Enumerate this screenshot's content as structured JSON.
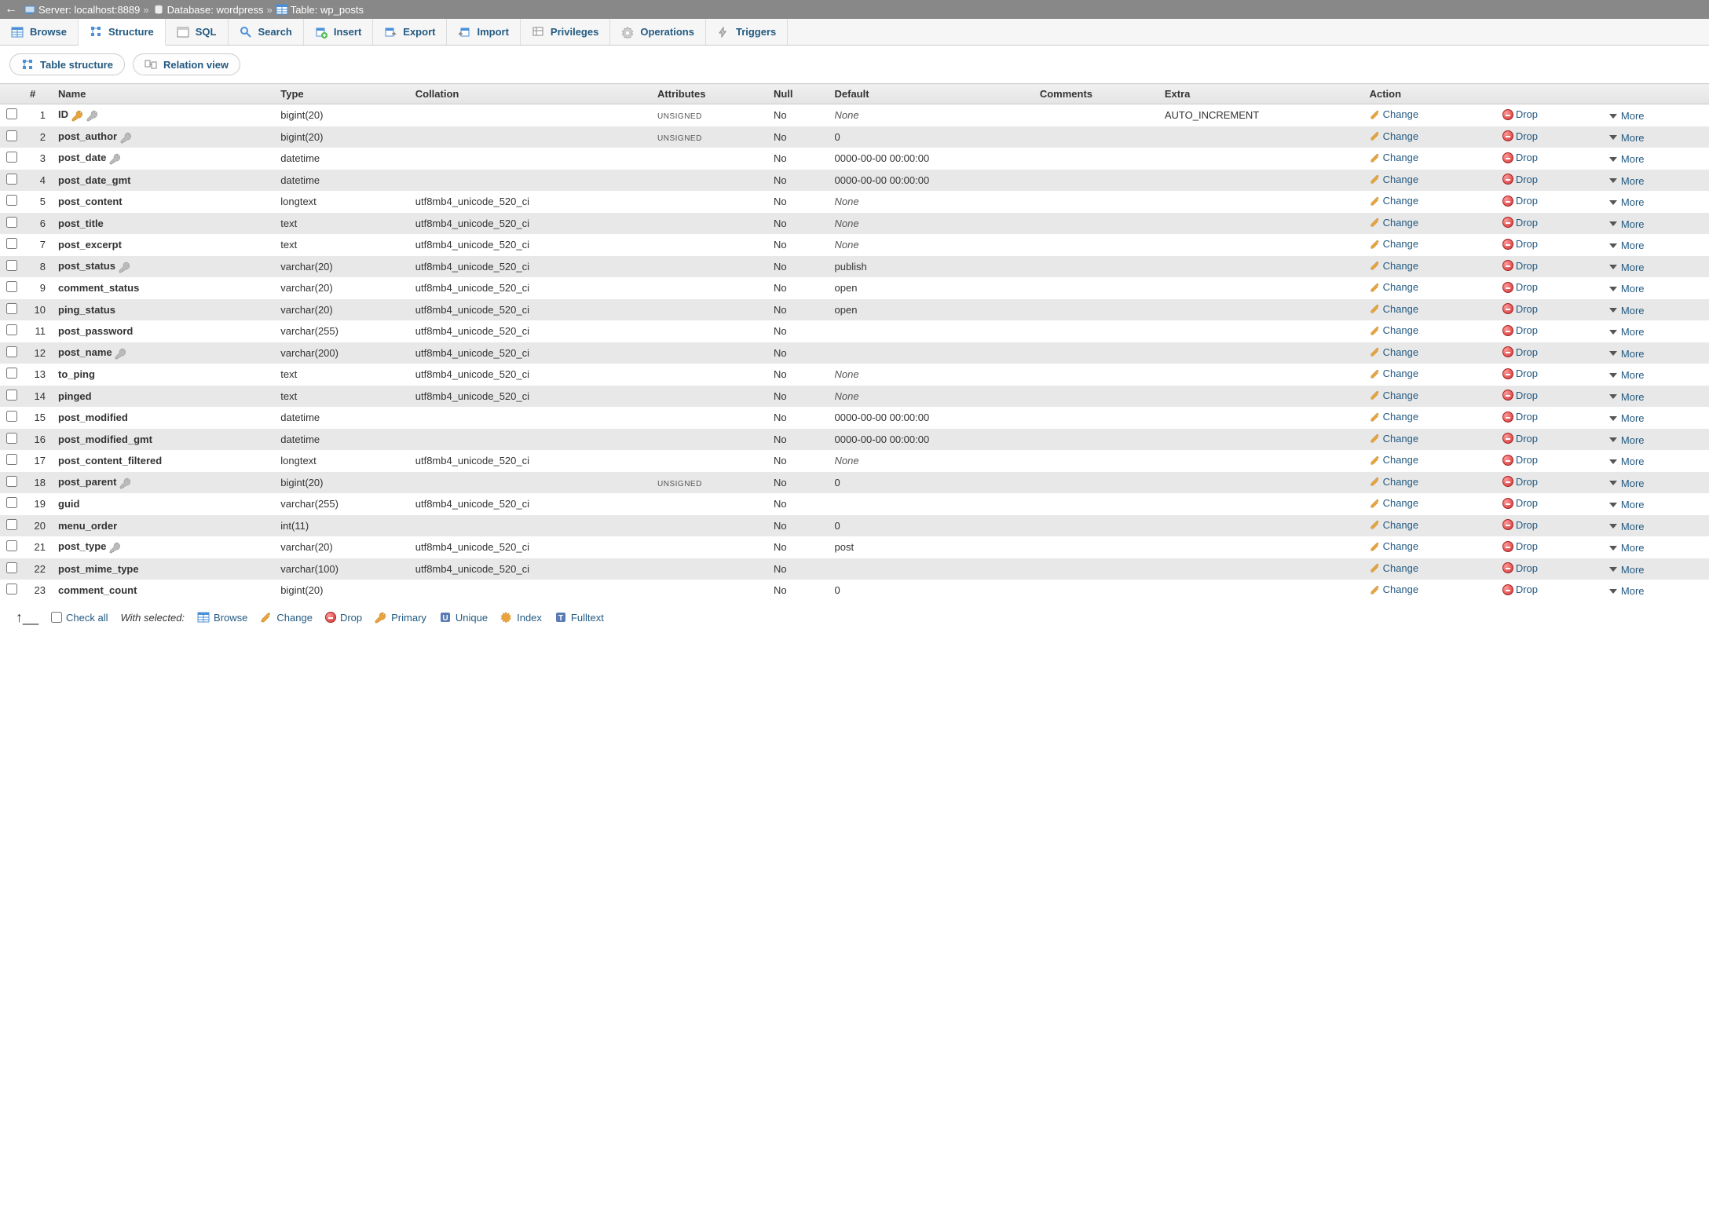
{
  "breadcrumb": {
    "server_label": "Server:",
    "server_value": "localhost:8889",
    "database_label": "Database:",
    "database_value": "wordpress",
    "table_label": "Table:",
    "table_value": "wp_posts"
  },
  "tabs": [
    {
      "id": "browse",
      "label": "Browse"
    },
    {
      "id": "structure",
      "label": "Structure",
      "active": true
    },
    {
      "id": "sql",
      "label": "SQL"
    },
    {
      "id": "search",
      "label": "Search"
    },
    {
      "id": "insert",
      "label": "Insert"
    },
    {
      "id": "export",
      "label": "Export"
    },
    {
      "id": "import",
      "label": "Import"
    },
    {
      "id": "privileges",
      "label": "Privileges"
    },
    {
      "id": "operations",
      "label": "Operations"
    },
    {
      "id": "triggers",
      "label": "Triggers"
    }
  ],
  "subtabs": {
    "table_structure": "Table structure",
    "relation_view": "Relation view"
  },
  "headers": {
    "num": "#",
    "name": "Name",
    "type": "Type",
    "collation": "Collation",
    "attributes": "Attributes",
    "null": "Null",
    "default": "Default",
    "comments": "Comments",
    "extra": "Extra",
    "action": "Action"
  },
  "actions": {
    "change": "Change",
    "drop": "Drop",
    "more": "More"
  },
  "columns": [
    {
      "n": 1,
      "name": "ID",
      "type": "bigint(20)",
      "collation": "",
      "attributes": "UNSIGNED",
      "null": "No",
      "default": "None",
      "default_italic": true,
      "comments": "",
      "extra": "AUTO_INCREMENT",
      "primary": true,
      "index": true
    },
    {
      "n": 2,
      "name": "post_author",
      "type": "bigint(20)",
      "collation": "",
      "attributes": "UNSIGNED",
      "null": "No",
      "default": "0",
      "comments": "",
      "extra": "",
      "index": true
    },
    {
      "n": 3,
      "name": "post_date",
      "type": "datetime",
      "collation": "",
      "attributes": "",
      "null": "No",
      "default": "0000-00-00 00:00:00",
      "comments": "",
      "extra": "",
      "index": true
    },
    {
      "n": 4,
      "name": "post_date_gmt",
      "type": "datetime",
      "collation": "",
      "attributes": "",
      "null": "No",
      "default": "0000-00-00 00:00:00",
      "comments": "",
      "extra": ""
    },
    {
      "n": 5,
      "name": "post_content",
      "type": "longtext",
      "collation": "utf8mb4_unicode_520_ci",
      "attributes": "",
      "null": "No",
      "default": "None",
      "default_italic": true,
      "comments": "",
      "extra": ""
    },
    {
      "n": 6,
      "name": "post_title",
      "type": "text",
      "collation": "utf8mb4_unicode_520_ci",
      "attributes": "",
      "null": "No",
      "default": "None",
      "default_italic": true,
      "comments": "",
      "extra": ""
    },
    {
      "n": 7,
      "name": "post_excerpt",
      "type": "text",
      "collation": "utf8mb4_unicode_520_ci",
      "attributes": "",
      "null": "No",
      "default": "None",
      "default_italic": true,
      "comments": "",
      "extra": ""
    },
    {
      "n": 8,
      "name": "post_status",
      "type": "varchar(20)",
      "collation": "utf8mb4_unicode_520_ci",
      "attributes": "",
      "null": "No",
      "default": "publish",
      "comments": "",
      "extra": "",
      "index": true
    },
    {
      "n": 9,
      "name": "comment_status",
      "type": "varchar(20)",
      "collation": "utf8mb4_unicode_520_ci",
      "attributes": "",
      "null": "No",
      "default": "open",
      "comments": "",
      "extra": ""
    },
    {
      "n": 10,
      "name": "ping_status",
      "type": "varchar(20)",
      "collation": "utf8mb4_unicode_520_ci",
      "attributes": "",
      "null": "No",
      "default": "open",
      "comments": "",
      "extra": ""
    },
    {
      "n": 11,
      "name": "post_password",
      "type": "varchar(255)",
      "collation": "utf8mb4_unicode_520_ci",
      "attributes": "",
      "null": "No",
      "default": "",
      "comments": "",
      "extra": ""
    },
    {
      "n": 12,
      "name": "post_name",
      "type": "varchar(200)",
      "collation": "utf8mb4_unicode_520_ci",
      "attributes": "",
      "null": "No",
      "default": "",
      "comments": "",
      "extra": "",
      "index": true
    },
    {
      "n": 13,
      "name": "to_ping",
      "type": "text",
      "collation": "utf8mb4_unicode_520_ci",
      "attributes": "",
      "null": "No",
      "default": "None",
      "default_italic": true,
      "comments": "",
      "extra": ""
    },
    {
      "n": 14,
      "name": "pinged",
      "type": "text",
      "collation": "utf8mb4_unicode_520_ci",
      "attributes": "",
      "null": "No",
      "default": "None",
      "default_italic": true,
      "comments": "",
      "extra": ""
    },
    {
      "n": 15,
      "name": "post_modified",
      "type": "datetime",
      "collation": "",
      "attributes": "",
      "null": "No",
      "default": "0000-00-00 00:00:00",
      "comments": "",
      "extra": ""
    },
    {
      "n": 16,
      "name": "post_modified_gmt",
      "type": "datetime",
      "collation": "",
      "attributes": "",
      "null": "No",
      "default": "0000-00-00 00:00:00",
      "comments": "",
      "extra": ""
    },
    {
      "n": 17,
      "name": "post_content_filtered",
      "type": "longtext",
      "collation": "utf8mb4_unicode_520_ci",
      "attributes": "",
      "null": "No",
      "default": "None",
      "default_italic": true,
      "comments": "",
      "extra": ""
    },
    {
      "n": 18,
      "name": "post_parent",
      "type": "bigint(20)",
      "collation": "",
      "attributes": "UNSIGNED",
      "null": "No",
      "default": "0",
      "comments": "",
      "extra": "",
      "index": true
    },
    {
      "n": 19,
      "name": "guid",
      "type": "varchar(255)",
      "collation": "utf8mb4_unicode_520_ci",
      "attributes": "",
      "null": "No",
      "default": "",
      "comments": "",
      "extra": ""
    },
    {
      "n": 20,
      "name": "menu_order",
      "type": "int(11)",
      "collation": "",
      "attributes": "",
      "null": "No",
      "default": "0",
      "comments": "",
      "extra": ""
    },
    {
      "n": 21,
      "name": "post_type",
      "type": "varchar(20)",
      "collation": "utf8mb4_unicode_520_ci",
      "attributes": "",
      "null": "No",
      "default": "post",
      "comments": "",
      "extra": "",
      "index": true
    },
    {
      "n": 22,
      "name": "post_mime_type",
      "type": "varchar(100)",
      "collation": "utf8mb4_unicode_520_ci",
      "attributes": "",
      "null": "No",
      "default": "",
      "comments": "",
      "extra": ""
    },
    {
      "n": 23,
      "name": "comment_count",
      "type": "bigint(20)",
      "collation": "",
      "attributes": "",
      "null": "No",
      "default": "0",
      "comments": "",
      "extra": ""
    }
  ],
  "footer": {
    "check_all": "Check all",
    "with_selected": "With selected:",
    "browse": "Browse",
    "change": "Change",
    "drop": "Drop",
    "primary": "Primary",
    "unique": "Unique",
    "index": "Index",
    "fulltext": "Fulltext"
  }
}
